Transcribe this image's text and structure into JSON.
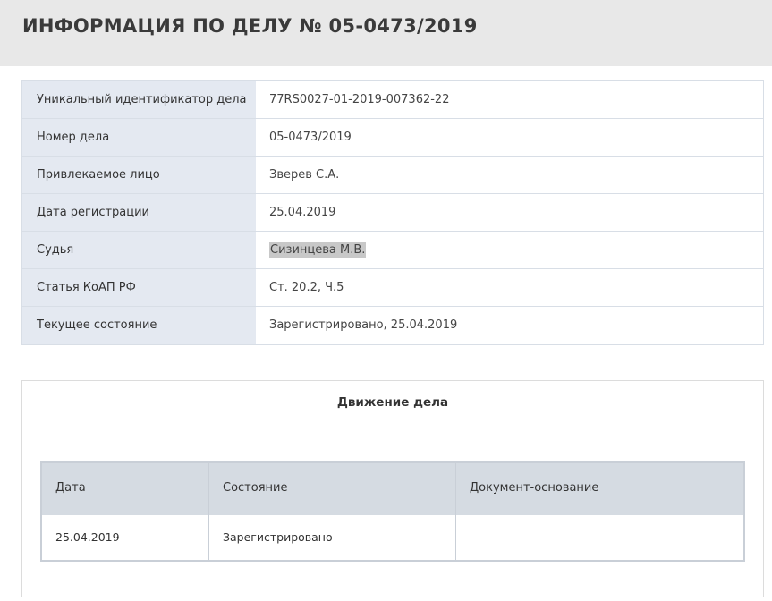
{
  "header": {
    "title": "ИНФОРМАЦИЯ ПО ДЕЛУ № 05-0473/2019"
  },
  "case_info": [
    {
      "label": "Уникальный идентификатор дела",
      "value": "77RS0027-01-2019-007362-22"
    },
    {
      "label": "Номер дела",
      "value": "05-0473/2019"
    },
    {
      "label": "Привлекаемое лицо",
      "value": "Зверев С.А."
    },
    {
      "label": "Дата регистрации",
      "value": "25.04.2019"
    },
    {
      "label": "Судья",
      "value": "Сизинцева М.В."
    },
    {
      "label": "Статья КоАП РФ",
      "value": "Ст. 20.2, Ч.5"
    },
    {
      "label": "Текущее состояние",
      "value": "Зарегистрировано, 25.04.2019"
    }
  ],
  "movement": {
    "title": "Движение дела",
    "columns": [
      "Дата",
      "Состояние",
      "Документ-основание"
    ],
    "rows": [
      {
        "date": "25.04.2019",
        "state": "Зарегистрировано",
        "document": ""
      }
    ]
  },
  "colors": {
    "header_bg": "#e8e8e8",
    "label_bg": "#e4e9f1",
    "table_head_bg": "#d5dbe2",
    "highlight_bg": "#c8c8c8"
  }
}
